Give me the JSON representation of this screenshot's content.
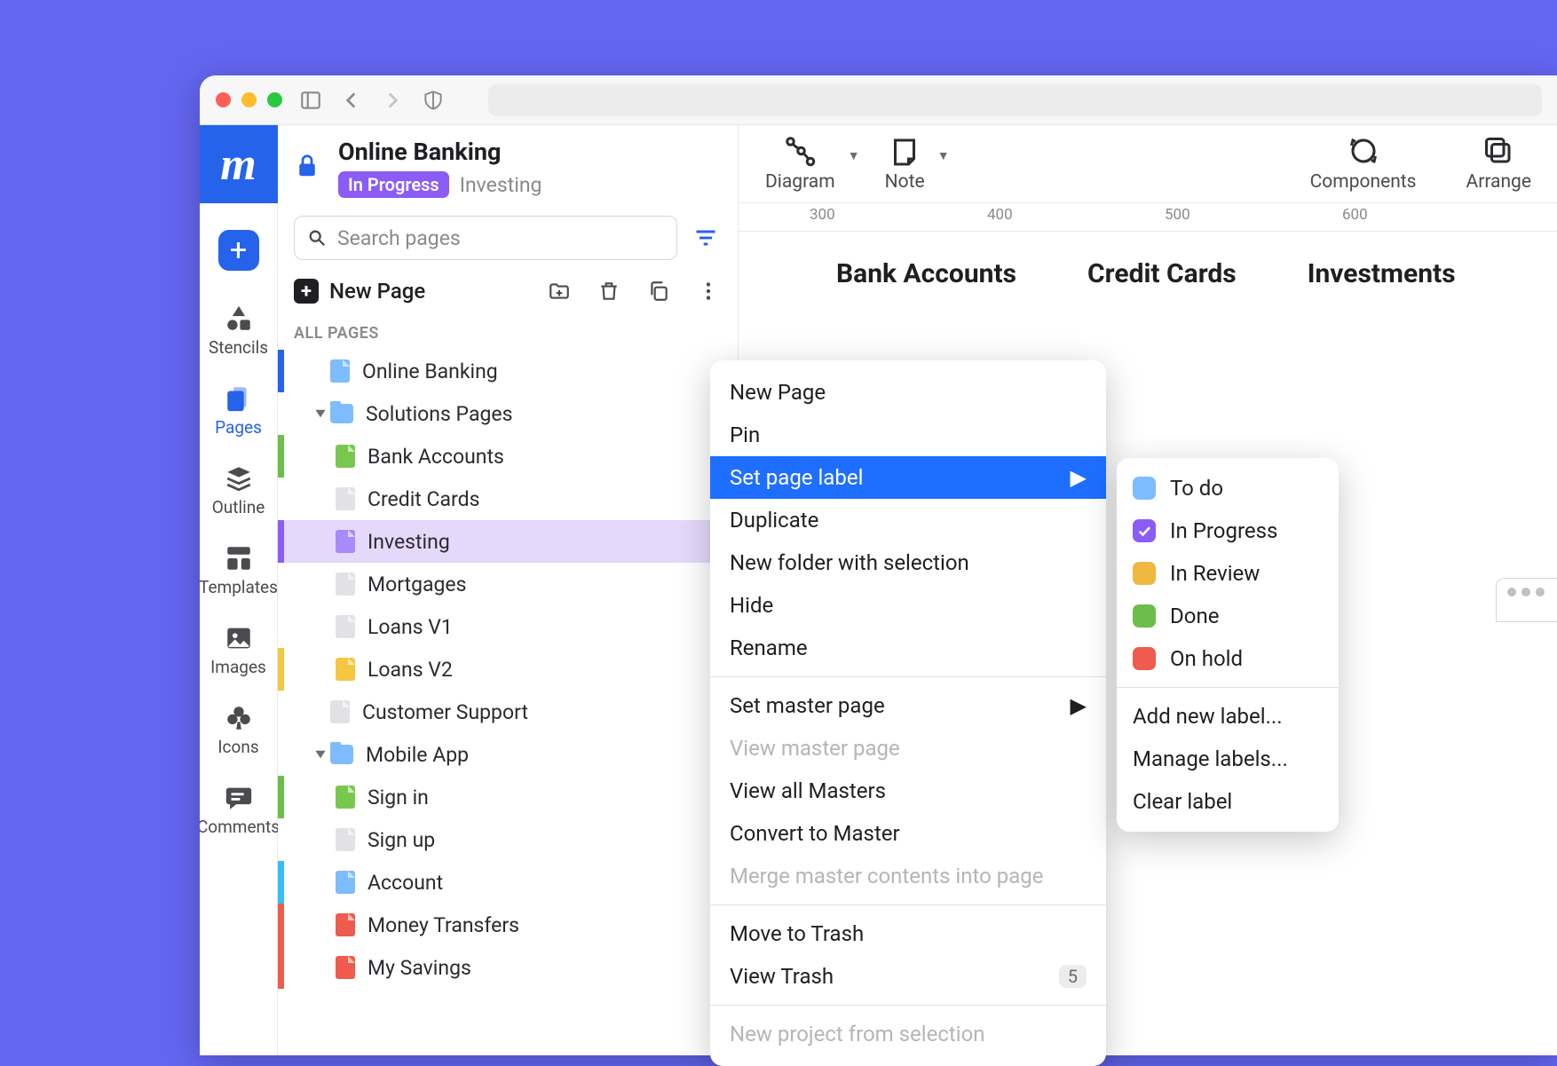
{
  "header": {
    "title": "Online Banking",
    "status_badge": "In Progress",
    "current_page": "Investing"
  },
  "search": {
    "placeholder": "Search pages"
  },
  "newpage": {
    "label": "New Page"
  },
  "section_label": "ALL PAGES",
  "rail": {
    "add": "+",
    "items": [
      {
        "label": "Stencils"
      },
      {
        "label": "Pages"
      },
      {
        "label": "Outline"
      },
      {
        "label": "Templates"
      },
      {
        "label": "Images"
      },
      {
        "label": "Icons"
      },
      {
        "label": "Comments"
      }
    ]
  },
  "toolbar": {
    "diagram": "Diagram",
    "note": "Note",
    "components": "Components",
    "arrange": "Arrange"
  },
  "ruler": {
    "ticks": [
      "300",
      "400",
      "500",
      "600"
    ]
  },
  "tabs": [
    "Bank Accounts",
    "Credit Cards",
    "Investments"
  ],
  "tree": [
    {
      "type": "page",
      "label": "Online Banking",
      "color": "c-blue-l",
      "stripe": "stripe-blue",
      "indent": 0
    },
    {
      "type": "folder",
      "label": "Solutions Pages",
      "color": "c-blue-l",
      "stripe": "stripe-none",
      "indent": 0,
      "open": true
    },
    {
      "type": "page",
      "label": "Bank Accounts",
      "color": "c-green",
      "stripe": "stripe-green",
      "indent": 1
    },
    {
      "type": "page",
      "label": "Credit Cards",
      "color": "c-grey",
      "stripe": "stripe-none",
      "indent": 1
    },
    {
      "type": "page",
      "label": "Investing",
      "color": "c-purple",
      "stripe": "stripe-purple",
      "indent": 1,
      "selected": true
    },
    {
      "type": "page",
      "label": "Mortgages",
      "color": "c-grey",
      "stripe": "stripe-none",
      "indent": 1
    },
    {
      "type": "page",
      "label": "Loans V1",
      "color": "c-grey",
      "stripe": "stripe-none",
      "indent": 1
    },
    {
      "type": "page",
      "label": "Loans V2",
      "color": "c-yellow",
      "stripe": "stripe-yellow",
      "indent": 1
    },
    {
      "type": "page",
      "label": "Customer Support",
      "color": "c-grey",
      "stripe": "stripe-none",
      "indent": 0
    },
    {
      "type": "folder",
      "label": "Mobile App",
      "color": "c-blue-l",
      "stripe": "stripe-none",
      "indent": 0,
      "open": true
    },
    {
      "type": "page",
      "label": "Sign in",
      "color": "c-green",
      "stripe": "stripe-green",
      "indent": 1
    },
    {
      "type": "page",
      "label": "Sign up",
      "color": "c-grey",
      "stripe": "stripe-none",
      "indent": 1
    },
    {
      "type": "page",
      "label": "Account",
      "color": "c-blue-l",
      "stripe": "stripe-cyan",
      "indent": 1
    },
    {
      "type": "page",
      "label": "Money Transfers",
      "color": "c-red",
      "stripe": "stripe-red",
      "indent": 1
    },
    {
      "type": "page",
      "label": "My Savings",
      "color": "c-red",
      "stripe": "stripe-red",
      "indent": 1
    }
  ],
  "ctx": {
    "items": [
      {
        "label": "New Page"
      },
      {
        "label": "Pin"
      },
      {
        "label": "Set page label",
        "submenu": true,
        "hl": true
      },
      {
        "label": "Duplicate"
      },
      {
        "label": "New folder with selection"
      },
      {
        "label": "Hide"
      },
      {
        "label": "Rename"
      },
      {
        "sep": true
      },
      {
        "label": "Set master page",
        "submenu": true
      },
      {
        "label": "View master page",
        "disabled": true
      },
      {
        "label": "View all Masters"
      },
      {
        "label": "Convert to Master"
      },
      {
        "label": "Merge master contents into page",
        "disabled": true
      },
      {
        "sep": true
      },
      {
        "label": "Move to Trash"
      },
      {
        "label": "View Trash",
        "count": "5"
      },
      {
        "sep": true
      },
      {
        "label": "New project from selection",
        "disabled": true
      }
    ]
  },
  "sub": {
    "labels": [
      {
        "label": "To do",
        "color": "c-blue-l"
      },
      {
        "label": "In Progress",
        "color": "c-purplechk",
        "check": true
      },
      {
        "label": "In Review",
        "color": "c-review"
      },
      {
        "label": "Done",
        "color": "c-green2"
      },
      {
        "label": "On hold",
        "color": "c-red"
      }
    ],
    "add_new": "Add new label...",
    "manage": "Manage labels...",
    "clear": "Clear label"
  }
}
